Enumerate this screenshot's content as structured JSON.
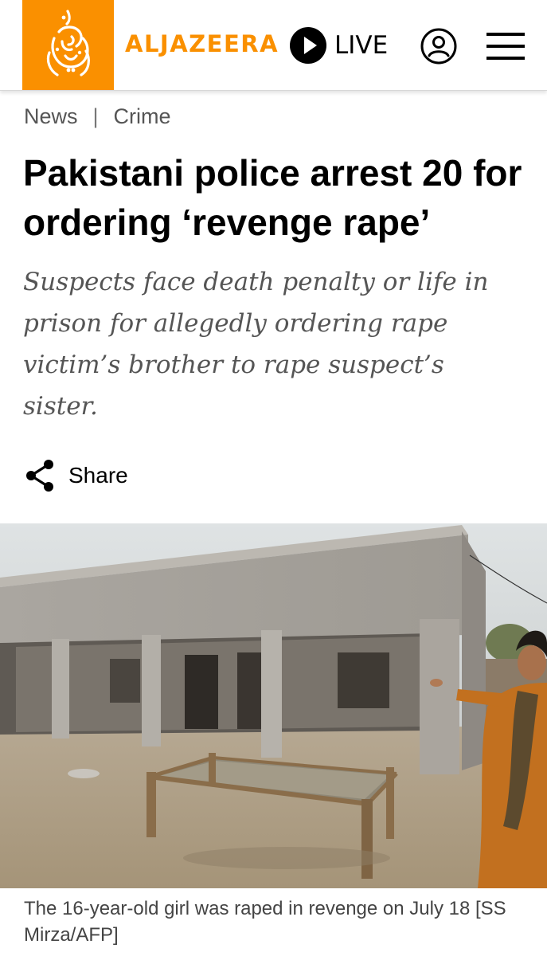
{
  "header": {
    "brand": "ALJAZEERA",
    "live_label": "LIVE",
    "brand_color": "#fa9000",
    "icons": [
      "aljazeera-logo",
      "play-icon",
      "account-icon",
      "menu-icon"
    ]
  },
  "breadcrumb": {
    "section": "News",
    "separator": "|",
    "category": "Crime"
  },
  "article": {
    "headline": "Pakistani police arrest 20 for ordering ‘revenge rape’",
    "subheadline": "Suspects face death penalty or life in prison for allegedly ordering rape victim’s brother to rape suspect’s sister.",
    "share_label": "Share",
    "share_icon": "share-icon",
    "caption": "The 16-year-old girl was raped in revenge on July 18 [SS Mirza/AFP]"
  }
}
